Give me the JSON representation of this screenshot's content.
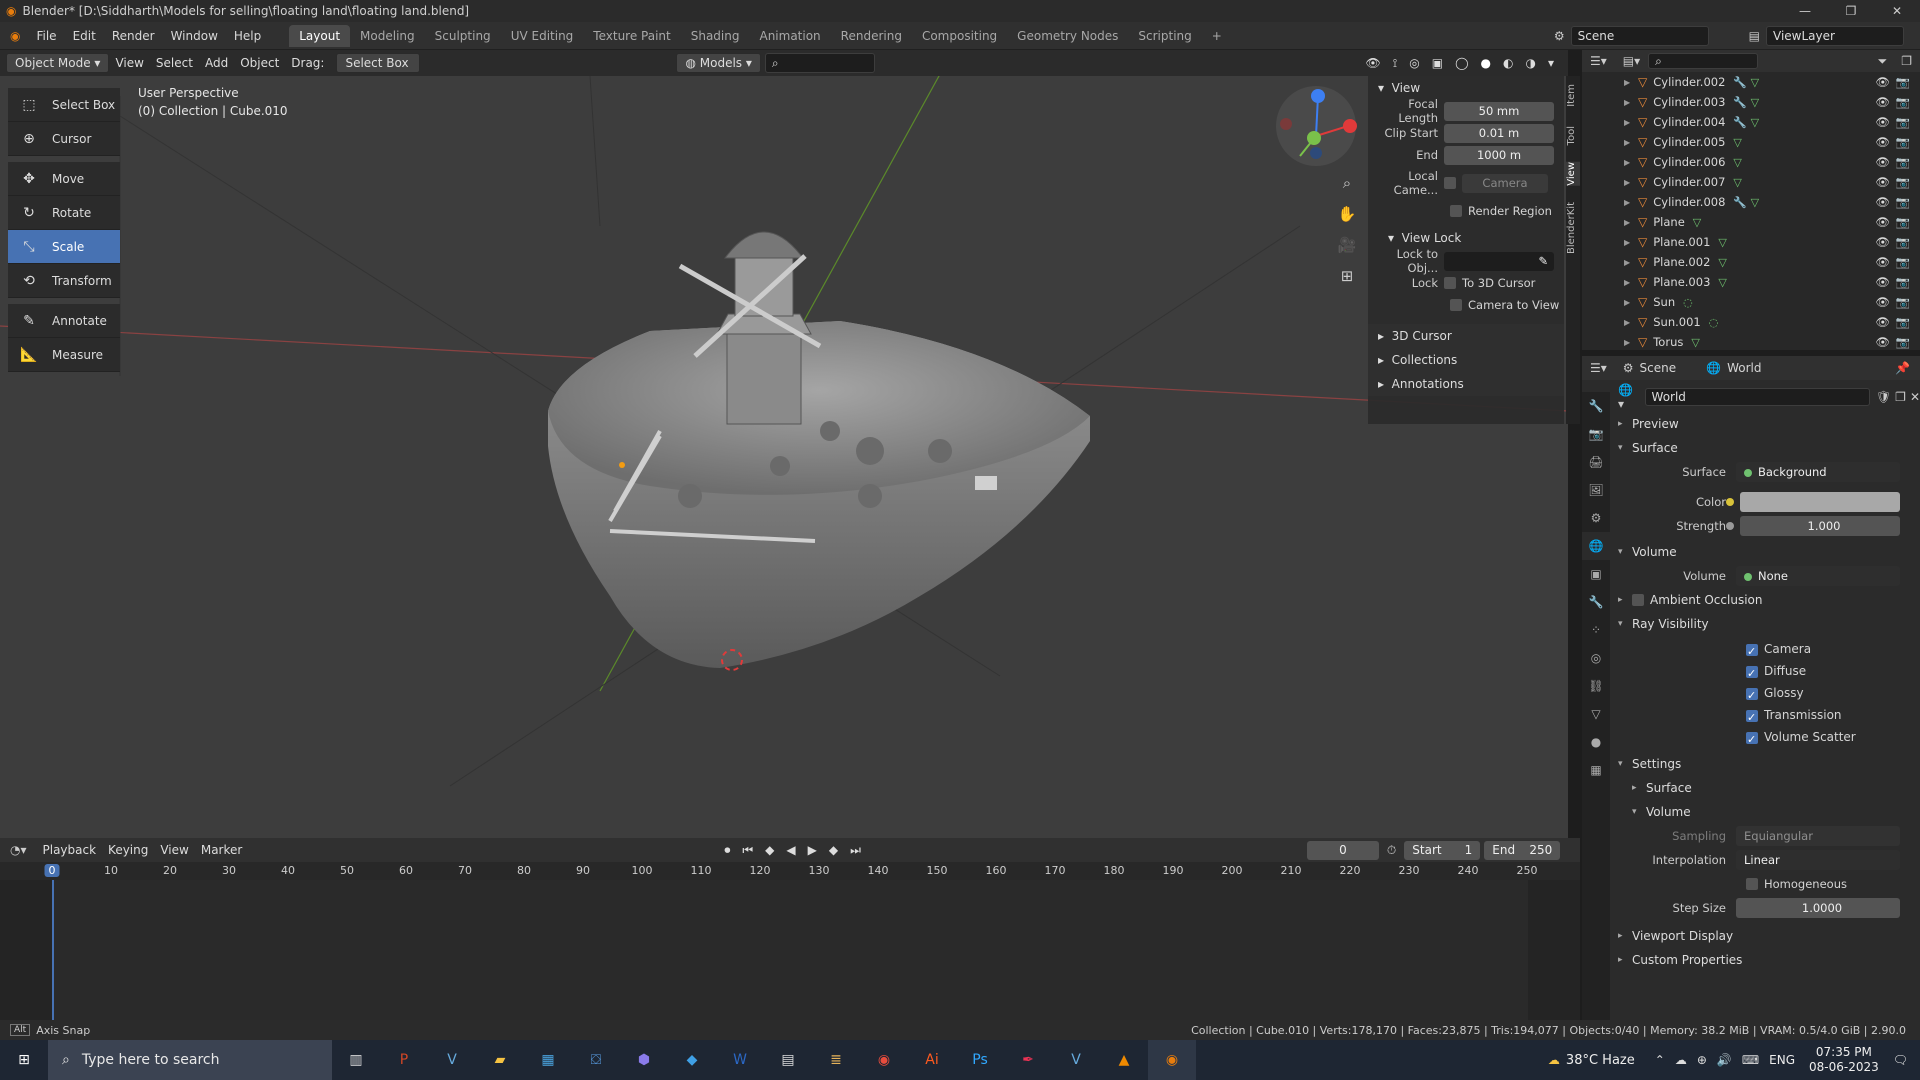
{
  "window": {
    "title": "Blender* [D:\\Siddharth\\Models for selling\\floating land\\floating land.blend]",
    "controls": [
      "—",
      "❐",
      "✕"
    ]
  },
  "topbar": {
    "menus": [
      "File",
      "Edit",
      "Render",
      "Window",
      "Help"
    ],
    "workspaces": [
      "Layout",
      "Modeling",
      "Sculpting",
      "UV Editing",
      "Texture Paint",
      "Shading",
      "Animation",
      "Rendering",
      "Compositing",
      "Geometry Nodes",
      "Scripting",
      "+"
    ],
    "active_workspace": "Layout",
    "scene": "Scene",
    "view_layer": "ViewLayer"
  },
  "viewport_header": {
    "mode": "Object Mode",
    "menus": [
      "View",
      "Select",
      "Add",
      "Object"
    ],
    "drag_label": "Drag:",
    "drag_value": "Select Box",
    "collection": "Models"
  },
  "toolbar": {
    "tools": [
      {
        "label": "Select Box",
        "icon": "select-box-icon",
        "glyph": "⬚"
      },
      {
        "label": "Cursor",
        "icon": "cursor-icon",
        "glyph": "⊕"
      },
      {
        "label": "Move",
        "icon": "move-icon",
        "glyph": "✥"
      },
      {
        "label": "Rotate",
        "icon": "rotate-icon",
        "glyph": "↻"
      },
      {
        "label": "Scale",
        "icon": "scale-icon",
        "glyph": "⤡"
      },
      {
        "label": "Transform",
        "icon": "transform-icon",
        "glyph": "⟲"
      },
      {
        "label": "Annotate",
        "icon": "annotate-icon",
        "glyph": "✎"
      },
      {
        "label": "Measure",
        "icon": "measure-icon",
        "glyph": "📐"
      }
    ],
    "active": "Scale"
  },
  "viewport": {
    "perspective": "User Perspective",
    "selection": "(0) Collection | Cube.010"
  },
  "npanel": {
    "section": "View",
    "focal_length_label": "Focal Length",
    "focal_length": "50 mm",
    "clip_start_label": "Clip Start",
    "clip_start": "0.01 m",
    "clip_end_label": "End",
    "clip_end": "1000 m",
    "local_camera_label": "Local Came...",
    "local_camera_value": "Camera",
    "render_region": "Render Region",
    "view_lock": "View Lock",
    "lock_to_obj_label": "Lock to Obj...",
    "lock_label": "Lock",
    "to_3d_cursor": "To 3D Cursor",
    "camera_to_view": "Camera to View",
    "collapsed": [
      "3D Cursor",
      "Collections",
      "Annotations"
    ],
    "tabs": [
      "Item",
      "Tool",
      "View",
      "BlenderKit"
    ]
  },
  "outliner": {
    "items": [
      {
        "name": "Cylinder.002",
        "mods": "🔧 ▽"
      },
      {
        "name": "Cylinder.003",
        "mods": "🔧 ▽"
      },
      {
        "name": "Cylinder.004",
        "mods": "🔧 ▽"
      },
      {
        "name": "Cylinder.005",
        "mods": "▽"
      },
      {
        "name": "Cylinder.006",
        "mods": "▽"
      },
      {
        "name": "Cylinder.007",
        "mods": "▽"
      },
      {
        "name": "Cylinder.008",
        "mods": "🔧 ▽"
      },
      {
        "name": "Plane",
        "mods": "▽"
      },
      {
        "name": "Plane.001",
        "mods": "▽"
      },
      {
        "name": "Plane.002",
        "mods": "▽"
      },
      {
        "name": "Plane.003",
        "mods": "▽"
      },
      {
        "name": "Sun",
        "mods": "◌"
      },
      {
        "name": "Sun.001",
        "mods": "◌"
      },
      {
        "name": "Torus",
        "mods": "▽"
      }
    ]
  },
  "properties": {
    "breadcrumb_scene": "Scene",
    "breadcrumb_world": "World",
    "world_name": "World",
    "preview": "Preview",
    "surface_section": "Surface",
    "surface_label": "Surface",
    "surface_value": "Background",
    "color_label": "Color",
    "color_swatch": "#a8a8a8",
    "strength_label": "Strength",
    "strength_value": "1.000",
    "volume_section": "Volume",
    "volume_label": "Volume",
    "volume_value": "None",
    "ambient_occlusion": "Ambient Occlusion",
    "ray_visibility": "Ray Visibility",
    "ray_items": [
      "Camera",
      "Diffuse",
      "Glossy",
      "Transmission",
      "Volume Scatter"
    ],
    "settings": "Settings",
    "settings_surface": "Surface",
    "settings_volume": "Volume",
    "sampling_label": "Sampling",
    "sampling_value": "Equiangular",
    "interpolation_label": "Interpolation",
    "interpolation_value": "Linear",
    "homogeneous": "Homogeneous",
    "step_size_label": "Step Size",
    "step_size_value": "1.0000",
    "viewport_display": "Viewport Display",
    "custom_properties": "Custom Properties"
  },
  "timeline": {
    "menus": [
      "Playback",
      "Keying",
      "View",
      "Marker"
    ],
    "current_frame": "0",
    "start_label": "Start",
    "start": "1",
    "end_label": "End",
    "end": "250",
    "ticks": [
      "0",
      "10",
      "20",
      "30",
      "40",
      "50",
      "60",
      "70",
      "80",
      "90",
      "100",
      "110",
      "120",
      "130",
      "140",
      "150",
      "160",
      "170",
      "180",
      "190",
      "200",
      "210",
      "220",
      "230",
      "240",
      "250"
    ]
  },
  "statusbar": {
    "left": "Axis Snap",
    "right": "Collection | Cube.010 | Verts:178,170 | Faces:23,875 | Tris:194,077 | Objects:0/40 | Memory: 38.2 MiB | VRAM: 0.5/4.0 GiB | 2.90.0"
  },
  "taskbar": {
    "search_placeholder": "Type here to search",
    "weather": "38°C Haze",
    "lang": "ENG",
    "time": "07:35 PM",
    "date": "08-06-2023"
  }
}
